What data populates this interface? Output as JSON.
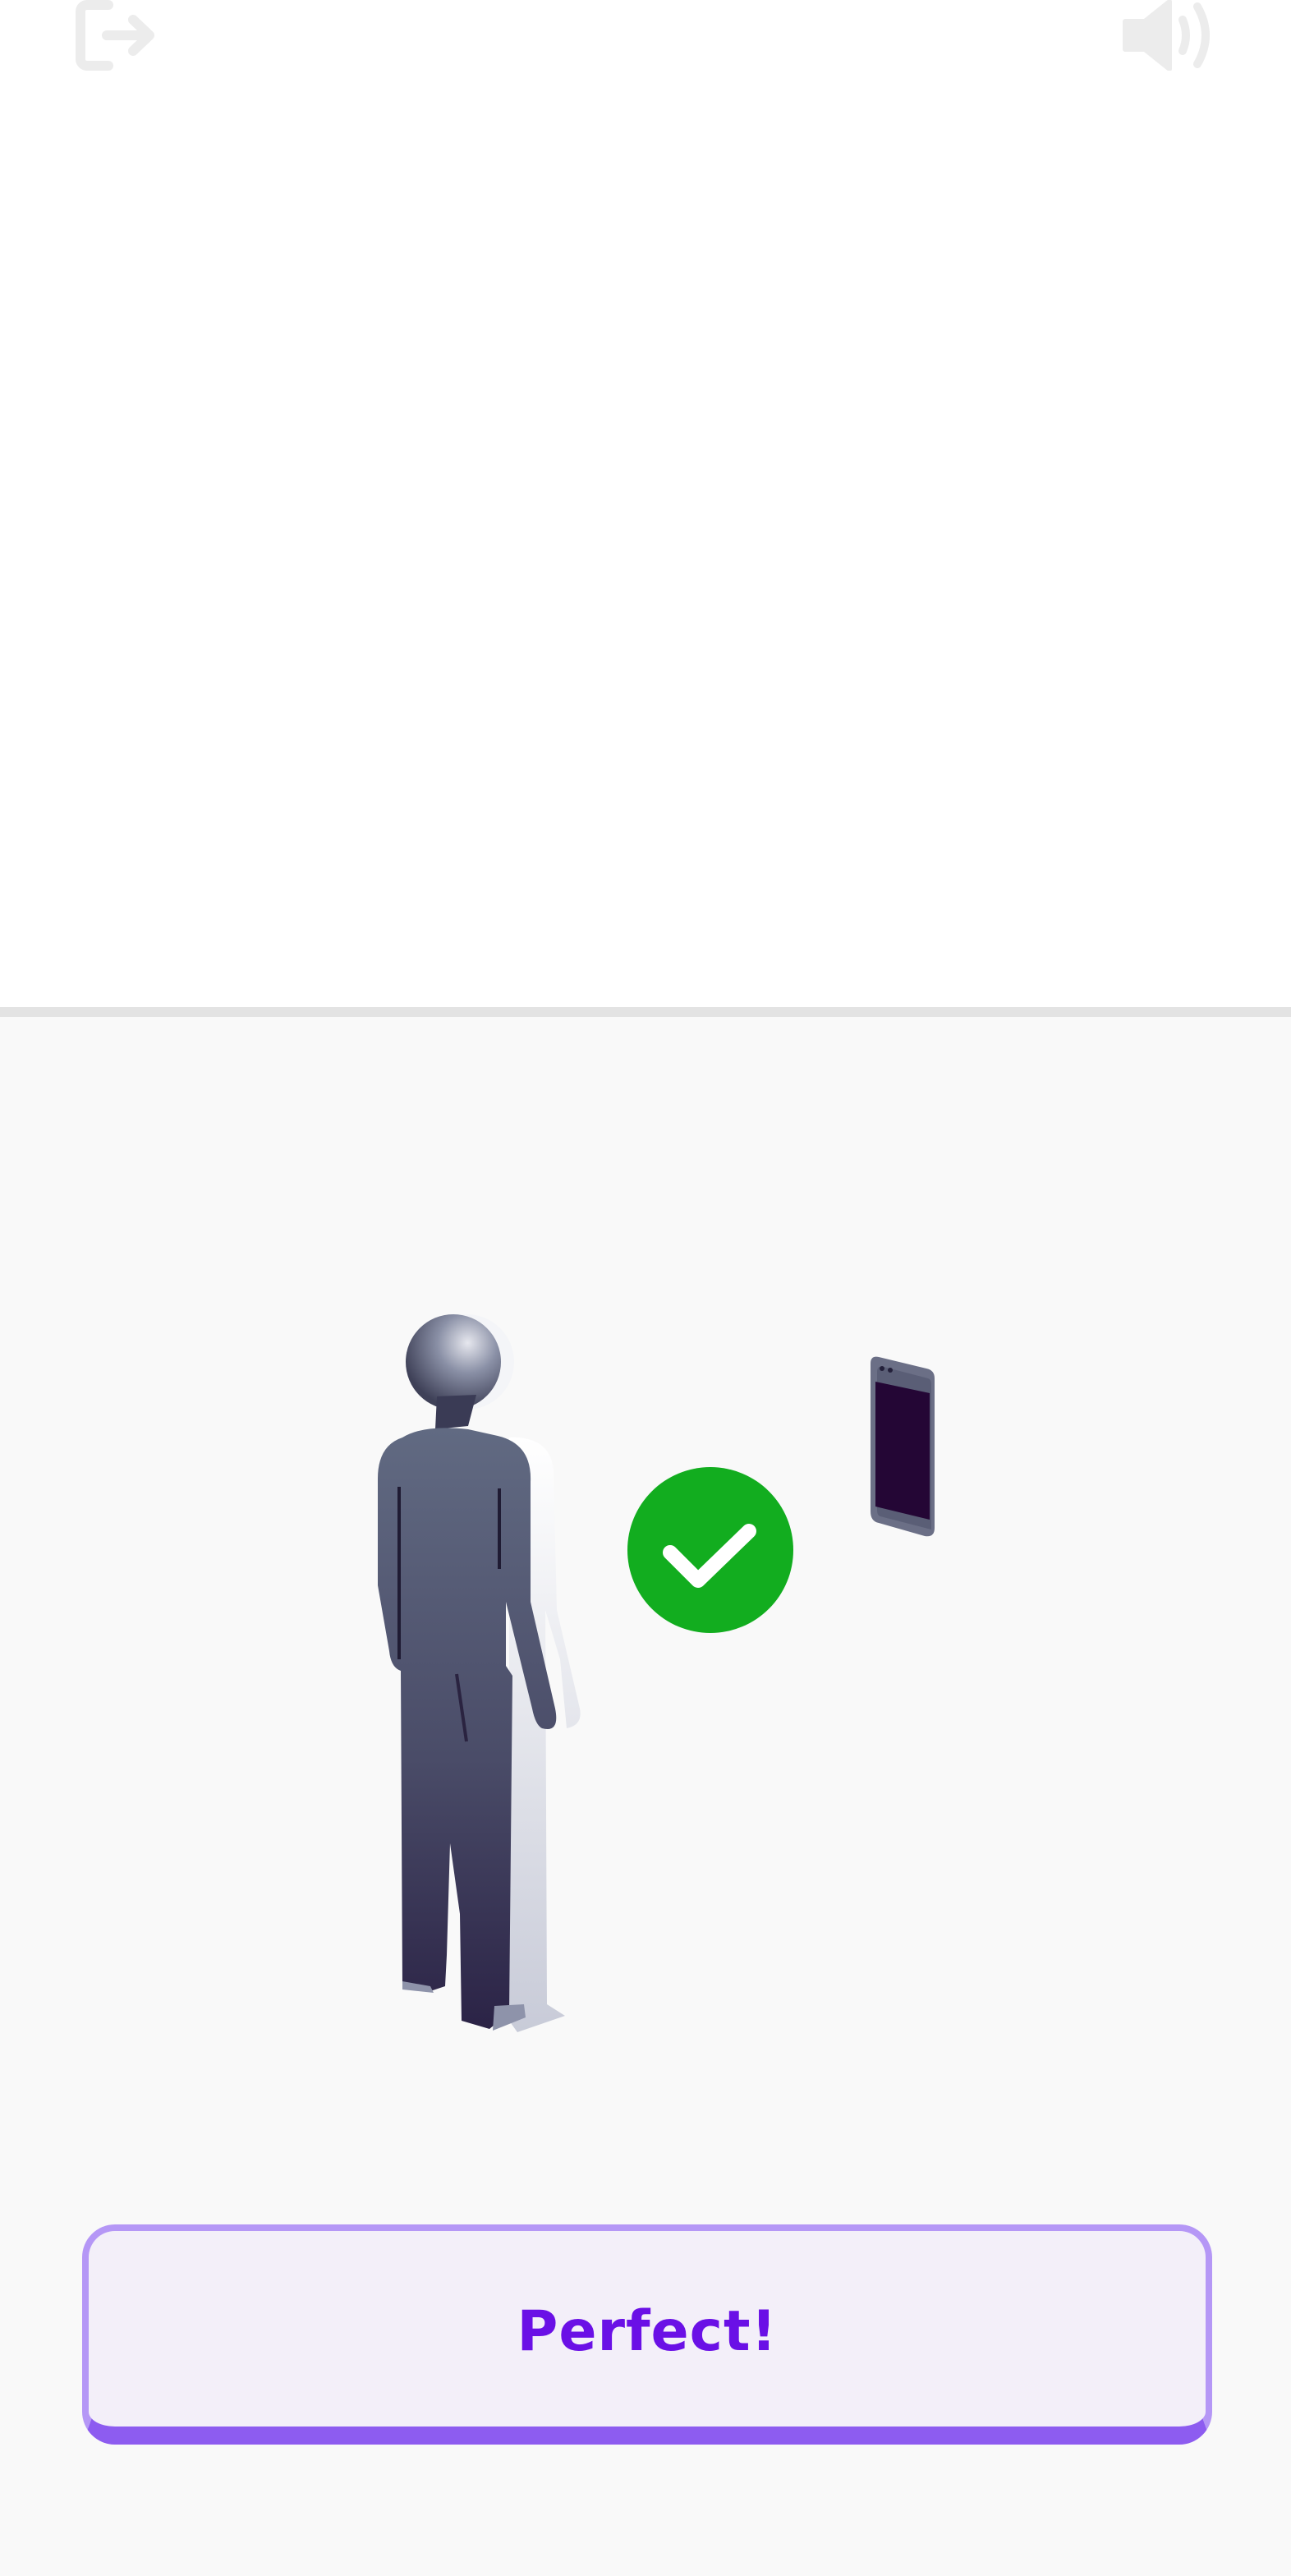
{
  "header": {
    "exit_icon": "exit-icon",
    "sound_icon": "speaker-icon"
  },
  "illustration": {
    "person_icon": "person-figure-icon",
    "phone_icon": "phone-icon",
    "status_icon": "checkmark-icon",
    "status_color": "#12ad1f"
  },
  "cta": {
    "label": "Perfect!",
    "text_color": "#6a10e6",
    "border_color": "#b597f6"
  }
}
